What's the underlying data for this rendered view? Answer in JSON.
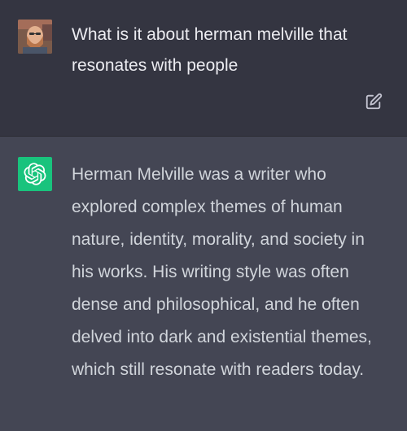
{
  "conversation": {
    "user_message": {
      "text": "What is it about herman melville that resonates with people",
      "avatar_icon": "user-avatar-photo"
    },
    "assistant_message": {
      "text": "Herman Melville was a writer who explored complex themes of human nature, identity, morality, and society in his works. His writing style was often dense and philosophical, and he often delved into dark and existential themes, which still resonate with readers today.",
      "avatar_icon": "chatgpt-logo-icon"
    }
  },
  "colors": {
    "user_bg": "#343541",
    "assistant_bg": "#444654",
    "bot_avatar_bg": "#19c37d",
    "text": "#ececf1"
  },
  "icons": {
    "edit": "edit-icon"
  }
}
